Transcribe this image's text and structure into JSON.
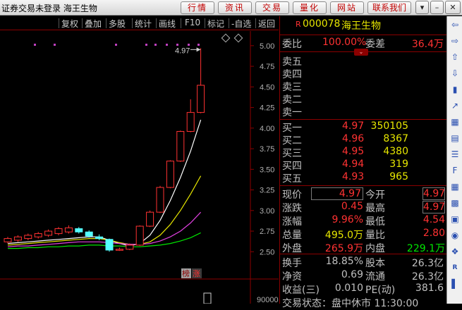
{
  "titlebar": {
    "title": "证券交易未登录  海王生物",
    "buttons": [
      "行情",
      "资讯",
      "交易",
      "量化",
      "网站",
      "联系我们"
    ]
  },
  "toolbar": {
    "items": [
      "复权",
      "叠加",
      "多股",
      "统计",
      "画线",
      "F10",
      "标记",
      "-自选",
      "返回"
    ]
  },
  "chart": {
    "price_axis": [
      "5.00",
      "4.75",
      "4.50",
      "4.25",
      "4.00",
      "3.75",
      "3.50",
      "3.25",
      "3.00",
      "2.75",
      "2.50"
    ],
    "volume_axis": "90000",
    "high_label": "4.97",
    "badge_a": "榜",
    "badge_b": "涨"
  },
  "chart_data": {
    "type": "candlestick",
    "y_range": [
      2.4,
      5.05
    ],
    "candles": [
      {
        "o": 2.62,
        "c": 2.66,
        "h": 2.68,
        "l": 2.6
      },
      {
        "o": 2.64,
        "c": 2.68,
        "h": 2.7,
        "l": 2.62
      },
      {
        "o": 2.66,
        "c": 2.7,
        "h": 2.72,
        "l": 2.64
      },
      {
        "o": 2.68,
        "c": 2.72,
        "h": 2.74,
        "l": 2.66
      },
      {
        "o": 2.7,
        "c": 2.75,
        "h": 2.77,
        "l": 2.68
      },
      {
        "o": 2.72,
        "c": 2.78,
        "h": 2.8,
        "l": 2.7
      },
      {
        "o": 2.74,
        "c": 2.79,
        "h": 2.82,
        "l": 2.72
      },
      {
        "o": 2.78,
        "c": 2.74,
        "h": 2.8,
        "l": 2.72
      },
      {
        "o": 2.74,
        "c": 2.69,
        "h": 2.76,
        "l": 2.67
      },
      {
        "o": 2.68,
        "c": 2.66,
        "h": 2.71,
        "l": 2.64
      },
      {
        "o": 2.65,
        "c": 2.52,
        "h": 2.66,
        "l": 2.5
      },
      {
        "o": 2.52,
        "c": 2.53,
        "h": 2.55,
        "l": 2.51
      },
      {
        "o": 2.53,
        "c": 2.58,
        "h": 2.6,
        "l": 2.52
      },
      {
        "o": 2.58,
        "c": 2.81,
        "h": 2.82,
        "l": 2.57
      },
      {
        "o": 2.81,
        "c": 2.98,
        "h": 3.0,
        "l": 2.8
      },
      {
        "o": 2.98,
        "c": 3.28,
        "h": 3.3,
        "l": 2.97
      },
      {
        "o": 3.28,
        "c": 3.6,
        "h": 3.61,
        "l": 3.27
      },
      {
        "o": 3.6,
        "c": 3.96,
        "h": 3.97,
        "l": 3.59
      },
      {
        "o": 3.96,
        "c": 4.19,
        "h": 4.35,
        "l": 3.95
      },
      {
        "o": 4.19,
        "c": 4.52,
        "h": 4.97,
        "l": 4.18
      }
    ],
    "ma": [
      [
        2.6,
        2.61,
        2.62,
        2.63,
        2.64,
        2.65,
        2.66,
        2.67,
        2.68,
        2.68,
        2.64,
        2.6,
        2.57,
        2.6,
        2.7,
        2.88,
        3.12,
        3.4,
        3.72,
        4.1
      ],
      [
        2.58,
        2.59,
        2.6,
        2.61,
        2.62,
        2.63,
        2.64,
        2.65,
        2.66,
        2.66,
        2.64,
        2.61,
        2.59,
        2.59,
        2.62,
        2.7,
        2.83,
        3.0,
        3.2,
        3.42
      ],
      [
        2.56,
        2.57,
        2.57,
        2.58,
        2.59,
        2.6,
        2.61,
        2.62,
        2.62,
        2.62,
        2.61,
        2.6,
        2.59,
        2.59,
        2.6,
        2.63,
        2.68,
        2.75,
        2.85,
        2.98
      ],
      [
        2.54,
        2.54,
        2.55,
        2.55,
        2.56,
        2.56,
        2.57,
        2.57,
        2.58,
        2.58,
        2.57,
        2.57,
        2.56,
        2.56,
        2.57,
        2.58,
        2.6,
        2.63,
        2.67,
        2.73
      ]
    ],
    "ma_colors": [
      "#ffffff",
      "#e6e600",
      "#e040e0",
      "#00e600"
    ]
  },
  "quote": {
    "marker": "R",
    "code": "000078",
    "name": "海王生物",
    "ratio_label": "委比",
    "ratio_value": "100.00%",
    "diff_label": "委差",
    "diff_value": "36.4万",
    "sell": [
      {
        "label": "卖五",
        "price": "",
        "vol": ""
      },
      {
        "label": "卖四",
        "price": "",
        "vol": ""
      },
      {
        "label": "卖三",
        "price": "",
        "vol": ""
      },
      {
        "label": "卖二",
        "price": "",
        "vol": ""
      },
      {
        "label": "卖一",
        "price": "",
        "vol": ""
      }
    ],
    "buy": [
      {
        "label": "买一",
        "price": "4.97",
        "vol": "350105"
      },
      {
        "label": "买二",
        "price": "4.96",
        "vol": "8367"
      },
      {
        "label": "买三",
        "price": "4.95",
        "vol": "4380"
      },
      {
        "label": "买四",
        "price": "4.94",
        "vol": "319"
      },
      {
        "label": "买五",
        "price": "4.93",
        "vol": "965"
      }
    ],
    "stats": [
      {
        "l1": "现价",
        "v1": "4.97",
        "l2": "今开",
        "v2": "4.97"
      },
      {
        "l1": "涨跌",
        "v1": "0.45",
        "l2": "最高",
        "v2": "4.97"
      },
      {
        "l1": "涨幅",
        "v1": "9.96%",
        "l2": "最低",
        "v2": "4.54"
      },
      {
        "l1": "总量",
        "v1": "495.0万",
        "l2": "量比",
        "v2": "2.80"
      },
      {
        "l1": "外盘",
        "v1": "265.9万",
        "l2": "内盘",
        "v2": "229.1万"
      }
    ],
    "stats2": [
      {
        "l1": "换手",
        "v1": "18.85%",
        "l2": "股本",
        "v2": "26.3亿"
      },
      {
        "l1": "净资",
        "v1": "0.69",
        "l2": "流通",
        "v2": "26.3亿"
      },
      {
        "l1": "收益(三)",
        "v1": "0.010",
        "l2": "PE(动)",
        "v2": "381.6"
      }
    ],
    "bottom": "交易状态：盘中休市 11:30:00"
  },
  "sidebar": {
    "icons": [
      "arrow-left-icon",
      "arrow-right-icon",
      "arrow-up-icon",
      "arrow-down-icon",
      "candle-icon",
      "trend-icon",
      "grid-icon",
      "document-icon",
      "list-icon",
      "f10-icon",
      "table-icon",
      "chart-icon",
      "picture-icon",
      "coins-icon",
      "compass-icon",
      "rsi-icon",
      "bars-icon"
    ]
  }
}
